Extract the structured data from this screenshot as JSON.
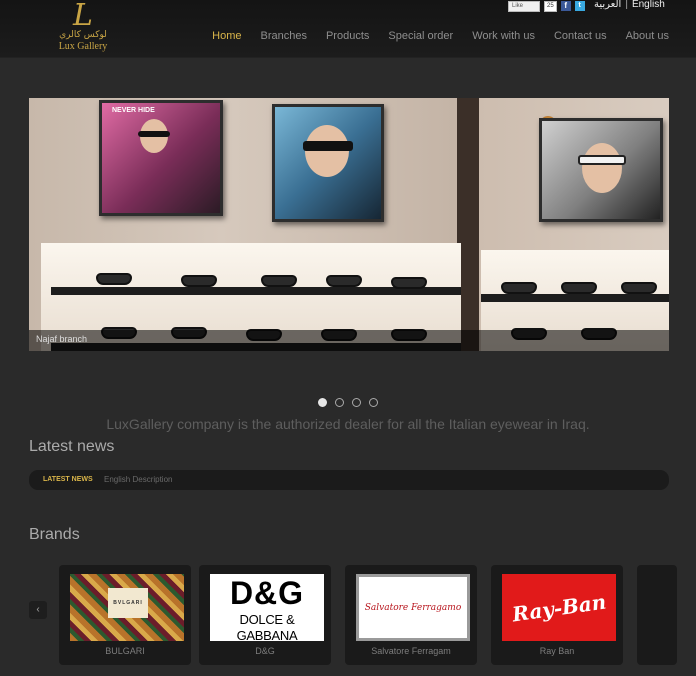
{
  "header": {
    "logo": {
      "mark": "L",
      "arabic": "لوكس كالري",
      "english": "Lux Gallery"
    },
    "social": {
      "like_label": "Like",
      "like_count": "25",
      "facebook_icon": "f",
      "twitter_icon": "t"
    },
    "language": {
      "arabic": "العربية",
      "separator": "|",
      "english": "English"
    },
    "nav": [
      {
        "label": "Home",
        "active": true
      },
      {
        "label": "Branches",
        "active": false
      },
      {
        "label": "Products",
        "active": false
      },
      {
        "label": "Special order",
        "active": false
      },
      {
        "label": "Work with us",
        "active": false
      },
      {
        "label": "Contact us",
        "active": false
      },
      {
        "label": "About us",
        "active": false
      }
    ]
  },
  "slider": {
    "caption": "Najaf branch",
    "poster_text": "NEVER HIDE",
    "slide_count": 4,
    "active_slide": 1
  },
  "tagline": "LuxGallery company is the authorized dealer for all the Italian eyewear in Iraq.",
  "news": {
    "title": "Latest news",
    "label": "LATEST NEWS",
    "text": "English Description"
  },
  "brands": {
    "title": "Brands",
    "prev_icon": "‹",
    "next_icon": "›",
    "items": [
      {
        "name": "BULGARI",
        "logo_text": "BVLGARI"
      },
      {
        "name": "D&G",
        "logo_big": "D&G",
        "logo_small": "DOLCE & GABBANA"
      },
      {
        "name": "Salvatore Ferragam",
        "logo_text": "Salvatore Ferragamo"
      },
      {
        "name": "Ray Ban",
        "logo_text": "Ray-Ban"
      }
    ]
  },
  "colors": {
    "accent": "#d9b54a",
    "background": "#2a2a2a",
    "rayban_red": "#e11a1a"
  }
}
